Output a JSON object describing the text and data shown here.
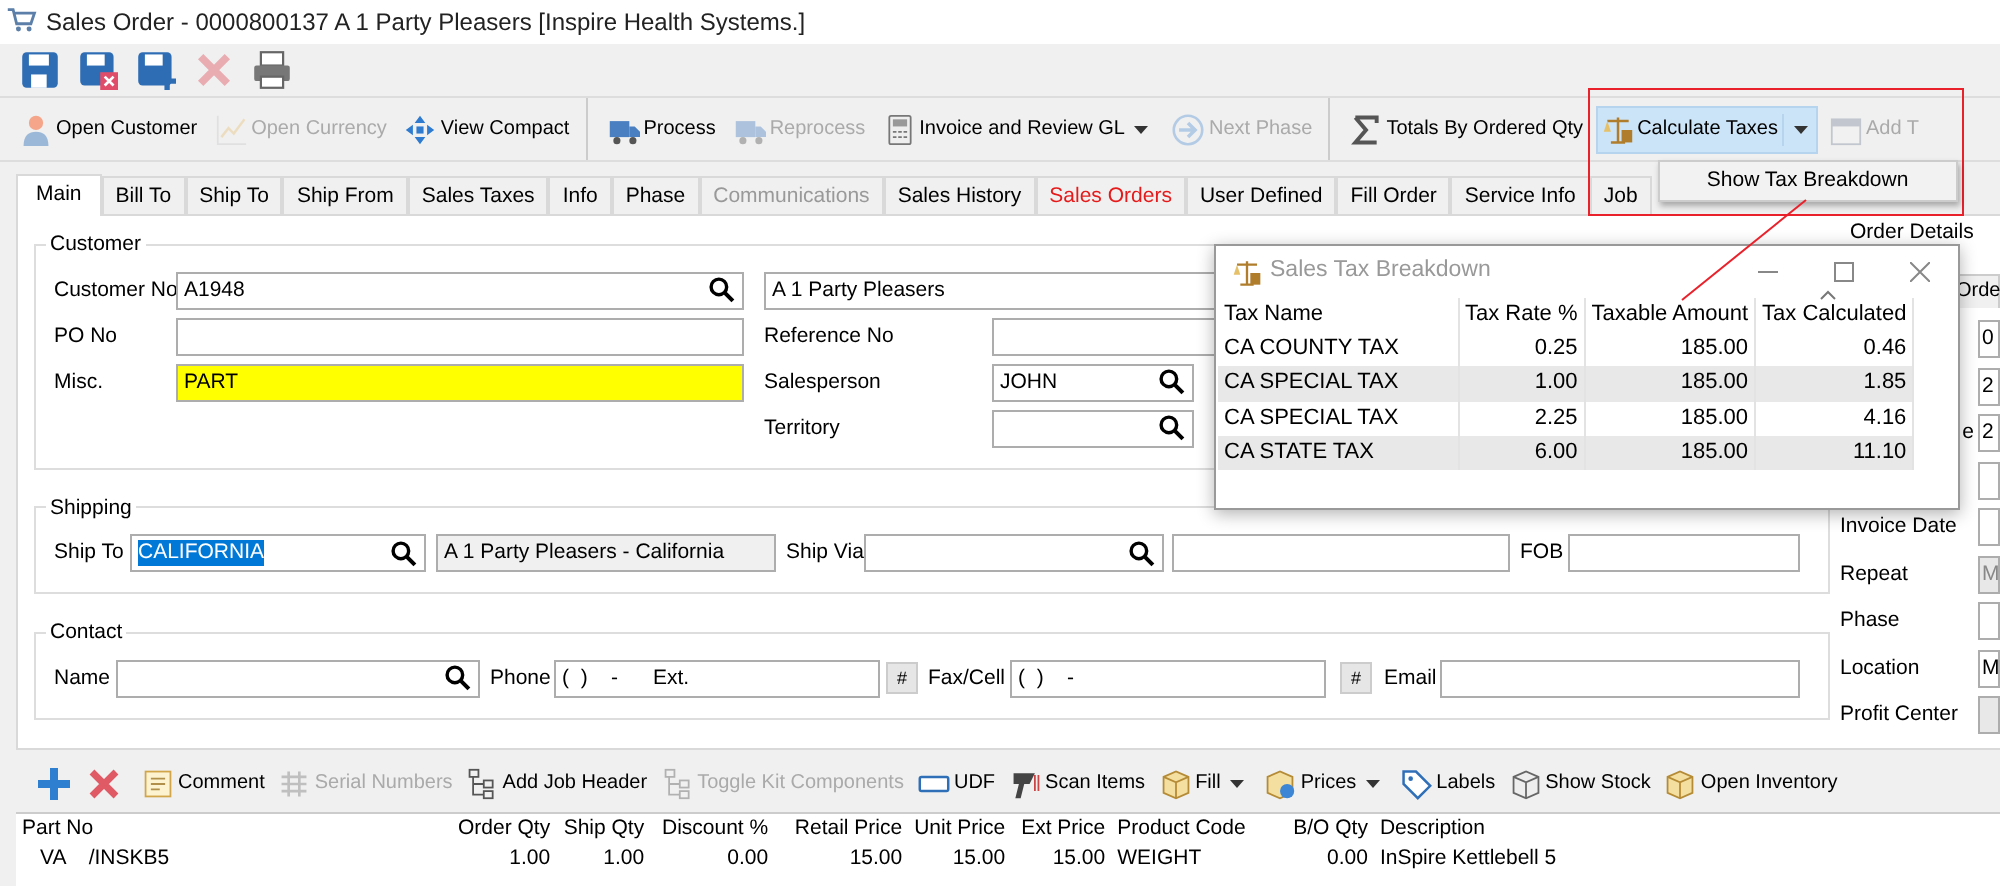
{
  "window": {
    "title": "Sales Order - 0000800137 A 1 Party Pleasers [Inspire Health Systems.]"
  },
  "quick_toolbar": [
    {
      "disabled": false
    },
    {
      "disabled": false
    },
    {
      "disabled": false
    },
    {
      "disabled": true
    },
    {
      "disabled": false
    }
  ],
  "toolbar_groups": [
    [
      {
        "label": "Open Customer",
        "disabled": false
      },
      {
        "label": "Open Currency",
        "disabled": true
      },
      {
        "label": "View Compact",
        "disabled": false
      }
    ],
    [
      {
        "label": "Process",
        "disabled": false
      },
      {
        "label": "Reprocess",
        "disabled": true
      },
      {
        "label": "Invoice and Review GL",
        "disabled": false,
        "dropdown": true
      },
      {
        "label": "Next Phase",
        "disabled": true
      }
    ],
    [
      {
        "label": "Totals By Ordered Qty",
        "disabled": false
      },
      {
        "label": "Calculate Taxes",
        "disabled": false,
        "dropdown": true,
        "active": true
      },
      {
        "label": "Add T",
        "disabled": true
      }
    ]
  ],
  "tax_menu": {
    "items": [
      "Show Tax Breakdown"
    ]
  },
  "tabs": [
    {
      "label": "Main",
      "selected": true,
      "disabled": false,
      "alert": false
    },
    {
      "label": "Bill To",
      "selected": false,
      "disabled": false,
      "alert": false
    },
    {
      "label": "Ship To",
      "selected": false,
      "disabled": false,
      "alert": false
    },
    {
      "label": "Ship From",
      "selected": false,
      "disabled": false,
      "alert": false
    },
    {
      "label": "Sales Taxes",
      "selected": false,
      "disabled": false,
      "alert": false
    },
    {
      "label": "Info",
      "selected": false,
      "disabled": false,
      "alert": false
    },
    {
      "label": "Phase",
      "selected": false,
      "disabled": false,
      "alert": false
    },
    {
      "label": "Communications",
      "selected": false,
      "disabled": true,
      "alert": false
    },
    {
      "label": "Sales History",
      "selected": false,
      "disabled": false,
      "alert": false
    },
    {
      "label": "Sales Orders",
      "selected": false,
      "disabled": false,
      "alert": true
    },
    {
      "label": "User Defined",
      "selected": false,
      "disabled": false,
      "alert": false
    },
    {
      "label": "Fill Order",
      "selected": false,
      "disabled": false,
      "alert": false
    },
    {
      "label": "Service Info",
      "selected": false,
      "disabled": false,
      "alert": false
    },
    {
      "label": "Job",
      "selected": false,
      "disabled": false,
      "alert": false
    }
  ],
  "groups": [
    {
      "title": "Customer",
      "rows": [
        [
          {
            "kind": "label",
            "text": "Customer No"
          },
          {
            "kind": "field",
            "value": "A1948",
            "lookup": true
          },
          {
            "kind": "field",
            "value": "A 1 Party Pleasers"
          }
        ],
        [
          {
            "kind": "label",
            "text": "PO No"
          },
          {
            "kind": "field"
          },
          {
            "kind": "label",
            "text": "Reference No"
          },
          {
            "kind": "field"
          }
        ],
        [
          {
            "kind": "label",
            "text": "Misc."
          },
          {
            "kind": "field",
            "value": "PART",
            "highlighted": true
          },
          {
            "kind": "label",
            "text": "Salesperson"
          },
          {
            "kind": "field",
            "value": "JOHN",
            "lookup": true
          }
        ],
        [
          {
            "kind": "spacer"
          },
          {
            "kind": "spacer"
          },
          {
            "kind": "label",
            "text": "Territory"
          },
          {
            "kind": "field",
            "lookup": true
          }
        ]
      ]
    },
    {
      "title": "Shipping",
      "rows": [
        [
          {
            "kind": "label",
            "text": "Ship To"
          },
          {
            "kind": "field",
            "value": "CALIFORNIA",
            "lookup": true,
            "selected_text": true
          },
          {
            "kind": "field",
            "value": "A 1 Party Pleasers - California",
            "readonly": true
          },
          {
            "kind": "label",
            "text": "Ship Via"
          },
          {
            "kind": "field",
            "lookup": true
          },
          {
            "kind": "field"
          },
          {
            "kind": "label",
            "text": "FOB"
          },
          {
            "kind": "field"
          }
        ]
      ]
    },
    {
      "title": "Contact",
      "rows": [
        [
          {
            "kind": "label",
            "text": "Name"
          },
          {
            "kind": "field",
            "lookup": true
          },
          {
            "kind": "label",
            "text": "Phone"
          },
          {
            "kind": "field",
            "value": "(  )    -      Ext."
          },
          {
            "kind": "button",
            "text": "#"
          },
          {
            "kind": "label",
            "text": "Fax/Cell"
          },
          {
            "kind": "field",
            "value": "(  )    -"
          },
          {
            "kind": "button",
            "text": "#"
          },
          {
            "kind": "label",
            "text": "Email"
          },
          {
            "kind": "field"
          }
        ]
      ]
    }
  ],
  "order_details": {
    "title": "Order Details",
    "tab": "Orde",
    "rows": [
      {
        "value": "0"
      },
      {
        "value": "2"
      },
      {
        "label": "e",
        "value": "2"
      },
      {},
      {
        "label": "Invoice Date"
      },
      {
        "label": "Repeat",
        "value": "M",
        "disabled": true
      },
      {
        "label": "Phase"
      },
      {
        "label": "Location",
        "value": "M"
      },
      {
        "label": "Profit Center",
        "disabled": true
      }
    ]
  },
  "tax_window": {
    "title": "Sales Tax Breakdown",
    "columns": [
      "Tax Name",
      "Tax Rate %",
      "Taxable Amount",
      "Tax Calculated"
    ],
    "rows": [
      [
        "CA COUNTY TAX",
        "0.25",
        "185.00",
        "0.46"
      ],
      [
        "CA SPECIAL TAX",
        "1.00",
        "185.00",
        "1.85"
      ],
      [
        "CA SPECIAL TAX",
        "2.25",
        "185.00",
        "4.16"
      ],
      [
        "CA STATE TAX",
        "6.00",
        "185.00",
        "11.10"
      ]
    ]
  },
  "line_toolbar": [
    {
      "disabled": false
    },
    {
      "disabled": false
    },
    {
      "label": "Comment",
      "disabled": false
    },
    {
      "label": "Serial Numbers",
      "disabled": true
    },
    {
      "label": "Add Job Header",
      "disabled": false
    },
    {
      "label": "Toggle Kit Components",
      "disabled": true
    },
    {
      "label": "UDF",
      "disabled": false
    },
    {
      "label": "Scan Items",
      "disabled": false
    },
    {
      "label": "Fill",
      "disabled": false,
      "dropdown": true
    },
    {
      "label": "Prices",
      "disabled": false,
      "dropdown": true
    },
    {
      "label": "Labels",
      "disabled": false
    },
    {
      "label": "Show Stock",
      "disabled": false
    },
    {
      "label": "Open Inventory",
      "disabled": false
    }
  ],
  "lines": {
    "columns": [
      "Part No",
      "Order Qty",
      "Ship Qty",
      "Discount %",
      "Retail Price",
      "Unit Price",
      "Ext Price",
      "Product Code",
      "B/O Qty",
      "Description"
    ],
    "rows": [
      [
        "VA    /INSKB5",
        "1.00",
        "1.00",
        "0.00",
        "15.00",
        "15.00",
        "15.00",
        "WEIGHT",
        "0.00",
        "InSpire Kettlebell 5"
      ]
    ]
  }
}
